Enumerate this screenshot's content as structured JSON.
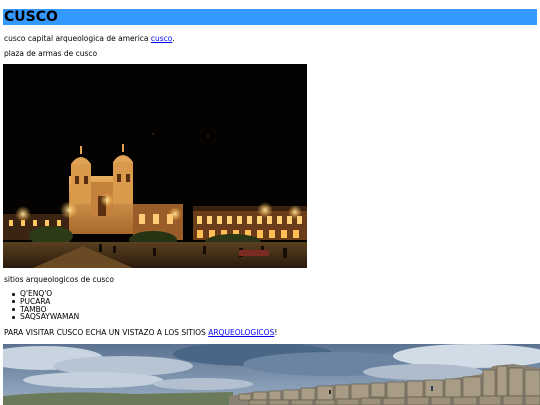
{
  "header": {
    "title": "CUSCO",
    "background_color": "#3399ff"
  },
  "intro": {
    "text": "cusco capital arqueologica de america ",
    "link_text": "cusco",
    "suffix": "."
  },
  "photo1": {
    "caption": "plaza de armas de cusco"
  },
  "sites": {
    "caption": "sitios arqueologicos de cusco",
    "items": [
      "Q'ENQ'O",
      "PUCARA",
      "TAMBO",
      "SAQSAYWAMAN"
    ]
  },
  "visit": {
    "text": "PARA VISITAR CUSCO ECHA UN VISTAZO A LOS SITIOS ",
    "link_text": "ARQUEOLOGICOS",
    "suffix": "!"
  },
  "link_color": "#0000ee"
}
